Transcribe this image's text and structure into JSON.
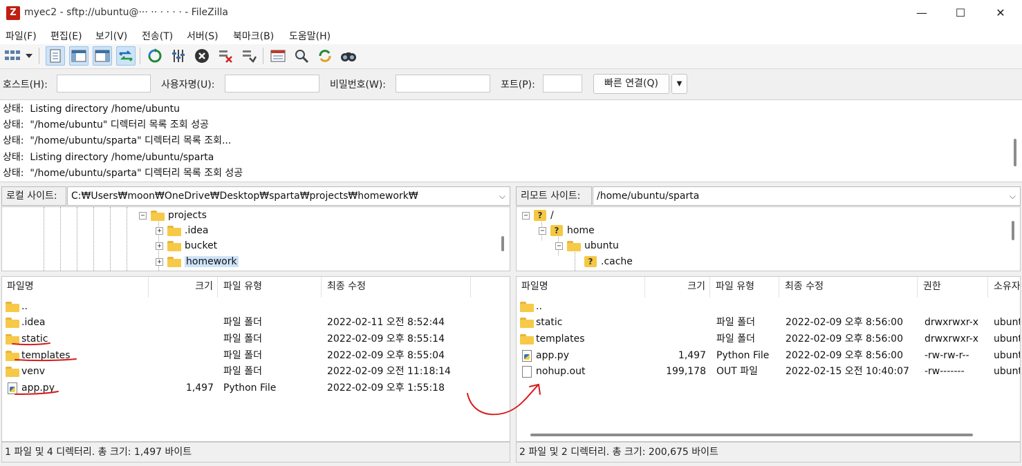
{
  "window": {
    "title": "myec2 - sftp://ubuntu@··· ·· · · ·  · - FileZilla",
    "app_icon_letter": "Z",
    "minimize": "—",
    "maximize": "☐",
    "close": "✕"
  },
  "menu": [
    "파일(F)",
    "편집(E)",
    "보기(V)",
    "전송(T)",
    "서버(S)",
    "북마크(B)",
    "도움말(H)"
  ],
  "toolbar": {
    "icons": [
      "site-manager-icon",
      "dropdown-arrow-icon",
      "toggle-message-log-icon",
      "toggle-local-tree-icon",
      "toggle-remote-tree-icon",
      "toggle-queue-icon",
      "refresh-icon",
      "process-queue-icon",
      "cancel-icon",
      "disconnect-icon",
      "reconnect-icon",
      "directory-listing-filter-icon",
      "compare-directories-icon",
      "sync-browsing-icon",
      "search-files-icon"
    ]
  },
  "quickconnect": {
    "host_label": "호스트(H):",
    "user_label": "사용자명(U):",
    "pass_label": "비밀번호(W):",
    "port_label": "포트(P):",
    "host_value": "",
    "user_value": "",
    "pass_value": "",
    "port_value": "",
    "connect_button": "빠른 연결(Q)",
    "dropdown_arrow": "▼"
  },
  "log": [
    {
      "prefix": "상태:",
      "text": "Listing directory /home/ubuntu"
    },
    {
      "prefix": "상태:",
      "text": "\"/home/ubuntu\" 디렉터리 목록 조회 성공"
    },
    {
      "prefix": "상태:",
      "text": "\"/home/ubuntu/sparta\" 디렉터리 목록 조회..."
    },
    {
      "prefix": "상태:",
      "text": "Listing directory /home/ubuntu/sparta"
    },
    {
      "prefix": "상태:",
      "text": "\"/home/ubuntu/sparta\" 디렉터리 목록 조회 성공"
    }
  ],
  "local": {
    "site_label": "로컬 사이트:",
    "path": "C:₩Users₩moon₩OneDrive₩Desktop₩sparta₩projects₩homework₩",
    "tree": [
      {
        "name": "projects",
        "expander": "⊟"
      },
      {
        "name": ".idea",
        "expander": "⊞"
      },
      {
        "name": "bucket",
        "expander": "⊞"
      },
      {
        "name": "homework",
        "expander": "⊞"
      }
    ],
    "columns": [
      "파일명",
      "크기",
      "파일 유형",
      "최종 수정"
    ],
    "files": [
      {
        "name": "..",
        "size": "",
        "type": "",
        "modified": ""
      },
      {
        "name": ".idea",
        "size": "",
        "type": "파일 폴더",
        "modified": "2022-02-11 오전 8:52:44"
      },
      {
        "name": "static",
        "size": "",
        "type": "파일 폴더",
        "modified": "2022-02-09 오후 8:55:14"
      },
      {
        "name": "templates",
        "size": "",
        "type": "파일 폴더",
        "modified": "2022-02-09 오후 8:55:04"
      },
      {
        "name": "venv",
        "size": "",
        "type": "파일 폴더",
        "modified": "2022-02-09 오전 11:18:14"
      },
      {
        "name": "app.py",
        "size": "1,497",
        "type": "Python File",
        "modified": "2022-02-09 오후 1:55:18"
      }
    ],
    "status": "1 파일 및 4 디렉터리. 총 크기: 1,497 바이트"
  },
  "remote": {
    "site_label": "리모트 사이트:",
    "path": "/home/ubuntu/sparta",
    "tree": [
      {
        "name": "/",
        "expander": "⊟"
      },
      {
        "name": "home",
        "expander": "⊟"
      },
      {
        "name": "ubuntu",
        "expander": "⊟"
      },
      {
        "name": ".cache",
        "expander": ""
      }
    ],
    "columns": [
      "파일명",
      "크기",
      "파일 유형",
      "최종 수정",
      "권한",
      "소유자"
    ],
    "files": [
      {
        "name": "..",
        "size": "",
        "type": "",
        "modified": "",
        "perm": "",
        "owner": ""
      },
      {
        "name": "static",
        "size": "",
        "type": "파일 폴더",
        "modified": "2022-02-09 오후 8:56:00",
        "perm": "drwxrwxr-x",
        "owner": "ubunt"
      },
      {
        "name": "templates",
        "size": "",
        "type": "파일 폴더",
        "modified": "2022-02-09 오후 8:56:00",
        "perm": "drwxrwxr-x",
        "owner": "ubunt"
      },
      {
        "name": "app.py",
        "size": "1,497",
        "type": "Python File",
        "modified": "2022-02-09 오후 8:56:00",
        "perm": "-rw-rw-r--",
        "owner": "ubunt"
      },
      {
        "name": "nohup.out",
        "size": "199,178",
        "type": "OUT 파일",
        "modified": "2022-02-15 오전 10:40:07",
        "perm": "-rw-------",
        "owner": "ubunt"
      }
    ],
    "status": "2 파일 및 2 디렉터리. 총 크기: 200,675 바이트"
  },
  "colors": {
    "annotation": "#d91a1a",
    "selection": "#cde3f7",
    "folder": "#f7c948"
  }
}
